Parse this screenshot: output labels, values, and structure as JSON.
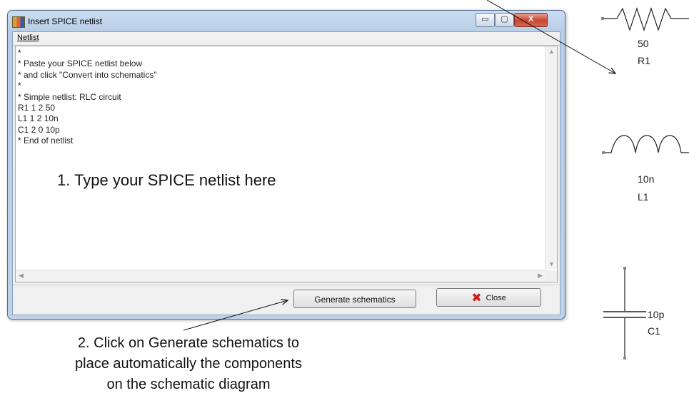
{
  "window": {
    "title": "Insert SPICE netlist",
    "controls": {
      "minimize": "▭",
      "maximize": "▢",
      "close": "X"
    }
  },
  "menu": {
    "netlist": "Netlist"
  },
  "editor": {
    "text": "*\n* Paste your SPICE netlist below\n* and click \"Convert into schematics\"\n*\n* Simple netlist: RLC circuit\nR1 1 2 50\nL1 1 2 10n\nC1 2 0 10p\n* End of netlist"
  },
  "buttons": {
    "generate_label": "Generate schematics",
    "close_label": "Close"
  },
  "annotations": {
    "step1": "1. Type your SPICE netlist here",
    "step2_line1": "2. Click on Generate schematics to",
    "step2_line2": "place automatically the components",
    "step2_line3": "on the schematic diagram"
  },
  "components": {
    "resistor": {
      "value": "50",
      "ref": "R1"
    },
    "inductor": {
      "value": "10n",
      "ref": "L1"
    },
    "capacitor": {
      "value": "10p",
      "ref": "C1"
    }
  },
  "colors": {
    "titlebar": "#c9dcf2",
    "close_button": "#c9452f",
    "close_icon": "#d01e1e"
  }
}
